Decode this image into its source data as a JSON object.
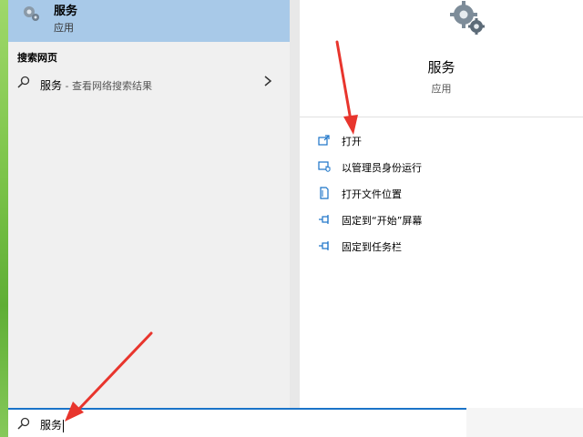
{
  "best_match": {
    "title": "服务",
    "subtitle": "应用"
  },
  "web_section": {
    "heading": "搜索网页",
    "query": "服务",
    "suffix": " - 查看网络搜索结果"
  },
  "details": {
    "title": "服务",
    "subtitle": "应用",
    "actions": [
      {
        "label": "打开",
        "icon": "open-icon"
      },
      {
        "label": "以管理员身份运行",
        "icon": "shield-admin-icon"
      },
      {
        "label": "打开文件位置",
        "icon": "file-location-icon"
      },
      {
        "label": "固定到“开始”屏幕",
        "icon": "pin-icon"
      },
      {
        "label": "固定到任务栏",
        "icon": "pin-icon"
      }
    ]
  },
  "search": {
    "value": "服务"
  },
  "colors": {
    "accent": "#1a73c8",
    "selected": "#a8c9e8",
    "arrow": "#e8352d"
  }
}
